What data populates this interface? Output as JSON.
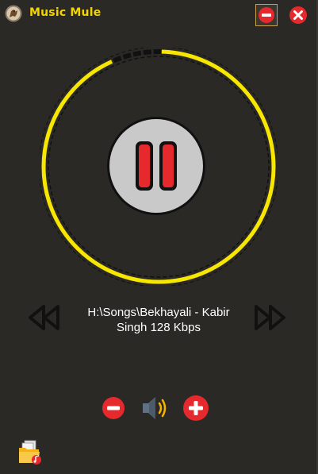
{
  "app": {
    "title": "Music Mule"
  },
  "window_controls": {
    "minimize_icon": "minus-circle-icon",
    "close_icon": "x-circle-icon"
  },
  "player": {
    "track_text": "H:\\Songs\\Bekhayali - Kabir Singh 128 Kbps",
    "state": "playing",
    "control_icon": "pause-icon",
    "progress_arc_color": "#f7e600"
  },
  "navigation": {
    "previous_icon": "rewind-icon",
    "next_icon": "fast-forward-icon"
  },
  "volume": {
    "down_icon": "minus-circle-icon",
    "speaker_icon": "speaker-icon",
    "up_icon": "plus-circle-icon"
  },
  "footer": {
    "open_icon": "folder-music-icon"
  },
  "colors": {
    "background": "#2b2925",
    "accent_yellow": "#f4d400",
    "button_red": "#e5292c",
    "disc_gray": "#c9c9c9"
  }
}
